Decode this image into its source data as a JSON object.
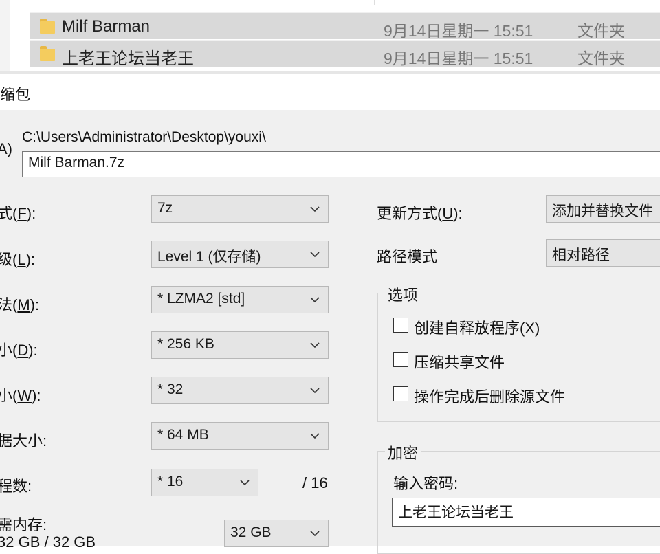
{
  "explorer": {
    "rows": [
      {
        "name": "Milf Barman",
        "date": "9月14日星期一 15:51",
        "type": "文件夹"
      },
      {
        "name": "上老王论坛当老王",
        "date": "9月14日星期一 15:51",
        "type": "文件夹"
      }
    ]
  },
  "dialog": {
    "title": "缩包",
    "archive_label": "A)",
    "archive_path": "C:\\Users\\Administrator\\Desktop\\youxi\\",
    "archive_name": "Milf Barman.7z",
    "left": {
      "format_label": "式(",
      "format_key": "F",
      "format_value": "7z",
      "level_label": "级(",
      "level_key": "L",
      "level_value": "Level 1 (仅存储)",
      "method_label": "法(",
      "method_key": "M",
      "method_value": "* LZMA2 [std]",
      "dict_label": "小(",
      "dict_key": "D",
      "dict_value": "* 256 KB",
      "word_label": "小(",
      "word_key": "W",
      "word_value": "* 32",
      "block_label": "据大小:",
      "block_value": "* 64 MB",
      "threads_label": "程数:",
      "threads_value": "* 16",
      "threads_max": "/ 16",
      "memory_label": "需内存:",
      "memory_usage": "32 GB / 32 GB",
      "memory_value": "32 GB"
    },
    "right": {
      "update_label": "更新方式(",
      "update_key": "U",
      "update_value": "添加并替换文件",
      "path_label": "路径模式",
      "path_value": "相对路径",
      "options_title": "选项",
      "options": [
        {
          "label": "创建自释放程序(X)"
        },
        {
          "label": "压缩共享文件"
        },
        {
          "label": "操作完成后删除源文件"
        }
      ],
      "encrypt_title": "加密",
      "password_label": "输入密码:",
      "password_value": "上老王论坛当老王"
    },
    "colon": "):"
  }
}
